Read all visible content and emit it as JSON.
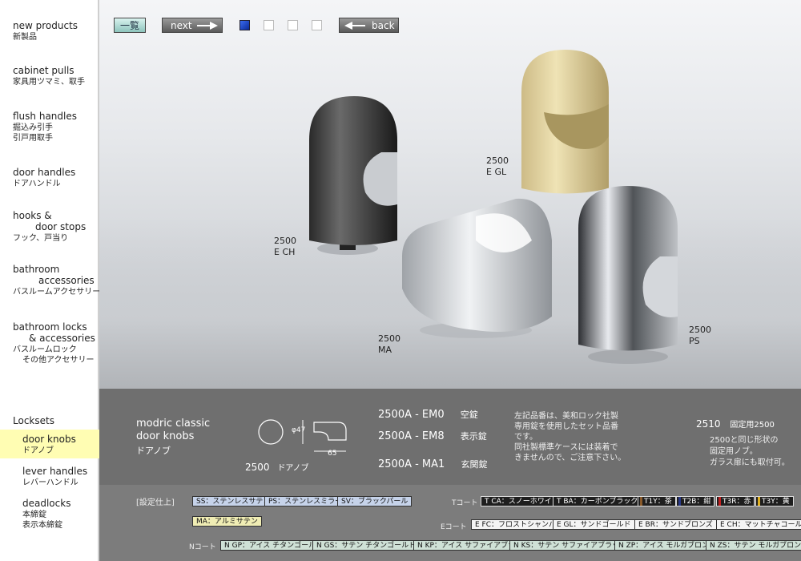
{
  "nav": {
    "items": [
      {
        "en": "new products",
        "ja": "新製品"
      },
      {
        "en": "cabinet pulls",
        "ja": "家具用ツマミ、取手"
      },
      {
        "en": "flush handles",
        "ja": "掘込み引手",
        "ja2": "引戸用取手"
      },
      {
        "en": "door handles",
        "ja": "ドアハンドル"
      },
      {
        "en": "hooks &",
        "en2": "door stops",
        "ja": "フック、戸当り"
      },
      {
        "en": "bathroom",
        "en2": "accessories",
        "ja": "バスルームアクセサリー"
      },
      {
        "en": "bathroom locks",
        "en2": "& accessories",
        "ja": "バスルームロック",
        "ja2": "その他アクセサリー"
      },
      {
        "en": "Locksets"
      },
      {
        "en": "door knobs",
        "ja": "ドアノブ"
      },
      {
        "en": "lever handles",
        "ja": "レバーハンドル"
      },
      {
        "en": "deadlocks",
        "ja": "本締錠",
        "ja2": "表示本締錠"
      }
    ]
  },
  "toolbar": {
    "list": "一覧",
    "next": "next",
    "back": "back"
  },
  "photo_labels": [
    {
      "code": "2500",
      "finish": "E CH"
    },
    {
      "code": "2500",
      "finish": "E GL"
    },
    {
      "code": "2500",
      "finish": "MA"
    },
    {
      "code": "2500",
      "finish": "PS"
    }
  ],
  "info": {
    "series_line1": "modric classic",
    "series_line2": "door knobs",
    "series_ja": "ドアノブ",
    "dim_diameter": "φ47",
    "dim_length": "65",
    "model_code": "2500",
    "model_ja": "ドアノブ",
    "variants": [
      {
        "code": "2500A - EM0",
        "type": "空錠"
      },
      {
        "code": "2500A - EM8",
        "type": "表示錠"
      },
      {
        "code": "2500A - MA1",
        "type": "玄関錠"
      }
    ],
    "note": [
      "左記品番は、美和ロック社製",
      "専用錠を使用したセット品番",
      "です。",
      "同社製標準ケースには装着で",
      "きませんので、ご注意下さい。"
    ],
    "fixed_code": "2510",
    "fixed_label": "固定用2500",
    "fixed_note": [
      "2500と同じ形状の",
      "固定用ノブ。",
      "ガラス扉にも取付可。"
    ]
  },
  "spec": {
    "title": "[設定仕上]",
    "t_label": "Tコート",
    "e_label": "Eコート",
    "n_label": "Nコート",
    "main_finishes": [
      {
        "text": "SS：ステンレスサテン"
      },
      {
        "text": "PS：ステンレスミラー"
      },
      {
        "text": "SV：ブラックパール"
      },
      {
        "text": "MA：アルミサテン"
      }
    ],
    "t_finishes": [
      {
        "text": "T CA：スノーホワイト"
      },
      {
        "text": "T BA：カーボンブラック"
      },
      {
        "text": "T1Y：茶",
        "swatch": "#8a5a2a"
      },
      {
        "text": "T2B：紺",
        "swatch": "#2a3a8a"
      },
      {
        "text": "T3R：赤",
        "swatch": "#c02020"
      },
      {
        "text": "T3Y：黄",
        "swatch": "#e0b020"
      }
    ],
    "e_finishes": [
      {
        "text": "E FC：フロストシャンパン"
      },
      {
        "text": "E GL：サンドゴールド"
      },
      {
        "text": "E BR：サンドブロンズ"
      },
      {
        "text": "E CH：マットチャコール"
      }
    ],
    "n_finishes": [
      {
        "text": "N GP：アイス チタンゴールド"
      },
      {
        "text": "N GS：サテン チタンゴールド"
      },
      {
        "text": "N KP：アイス サファイアブラック"
      },
      {
        "text": "N KS：サテン サファイアブラック"
      },
      {
        "text": "N ZP：アイス モルガブロンズ"
      },
      {
        "text": "N ZS：サテン モルガブロンズ"
      }
    ]
  }
}
